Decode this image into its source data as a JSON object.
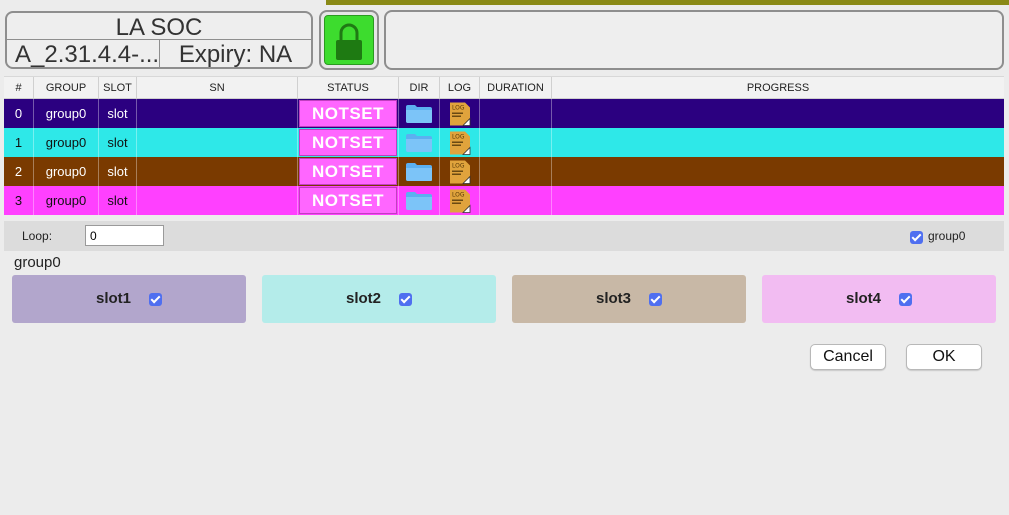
{
  "header": {
    "title": "LA SOC",
    "version": "A_2.31.4.4-...",
    "expiry": "Expiry: NA",
    "lock_icon": "lock-icon",
    "lock_color": "#3ddc2e",
    "message": ""
  },
  "table": {
    "columns": [
      "#",
      "GROUP",
      "SLOT",
      "SN",
      "STATUS",
      "DIR",
      "LOG",
      "DURATION",
      "PROGRESS"
    ],
    "rows": [
      {
        "index": "0",
        "group": "group0",
        "slot": "slot",
        "sn": "",
        "status": "NOTSET",
        "duration": "",
        "progress": "",
        "bg": "#2b0080",
        "fg": "#ffffff"
      },
      {
        "index": "1",
        "group": "group0",
        "slot": "slot",
        "sn": "",
        "status": "NOTSET",
        "duration": "",
        "progress": "",
        "bg": "#2ee8e8",
        "fg": "#111111"
      },
      {
        "index": "2",
        "group": "group0",
        "slot": "slot",
        "sn": "",
        "status": "NOTSET",
        "duration": "",
        "progress": "",
        "bg": "#7a3a00",
        "fg": "#ffffff"
      },
      {
        "index": "3",
        "group": "group0",
        "slot": "slot",
        "sn": "",
        "status": "NOTSET",
        "duration": "",
        "progress": "",
        "bg": "#ff40ff",
        "fg": "#111111"
      }
    ],
    "status_color": "#ff66ff",
    "dir_icon": "folder-icon",
    "log_icon": "log-file-icon"
  },
  "loop": {
    "label": "Loop:",
    "value": "0",
    "group_toggle_label": "group0",
    "group_toggle_checked": true
  },
  "group": {
    "title": "group0",
    "slots": [
      {
        "label": "slot1",
        "checked": true,
        "color": "#b2a6cc"
      },
      {
        "label": "slot2",
        "checked": true,
        "color": "#b4ecea"
      },
      {
        "label": "slot3",
        "checked": true,
        "color": "#c8b8a6"
      },
      {
        "label": "slot4",
        "checked": true,
        "color": "#f2bcf2"
      }
    ]
  },
  "actions": {
    "cancel_label": "Cancel",
    "ok_label": "OK"
  }
}
